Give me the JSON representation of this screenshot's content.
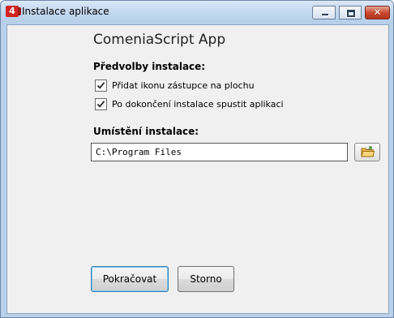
{
  "window": {
    "title": "Instalace aplikace",
    "icon": "comenia-app-icon",
    "controls": {
      "minimize": "minimize-icon",
      "maximize": "maximize-icon",
      "close_glyph": "✕"
    }
  },
  "app": {
    "name": "ComeniaScript App",
    "icon_letter": "4"
  },
  "preferences": {
    "heading": "Předvolby instalace:",
    "options": [
      {
        "label": "Přidat ikonu zástupce na plochu",
        "checked": true
      },
      {
        "label": "Po dokončení instalace spustit aplikaci",
        "checked": true
      }
    ]
  },
  "location": {
    "heading": "Umístění instalace:",
    "path": "C:\\Program Files",
    "browse_icon": "folder-icon"
  },
  "actions": {
    "continue_label": "Pokračovat",
    "cancel_label": "Storno"
  },
  "colors": {
    "accent": "#d22420",
    "focus_border": "#3c7fb1",
    "client_bg": "#f0f0f0"
  }
}
